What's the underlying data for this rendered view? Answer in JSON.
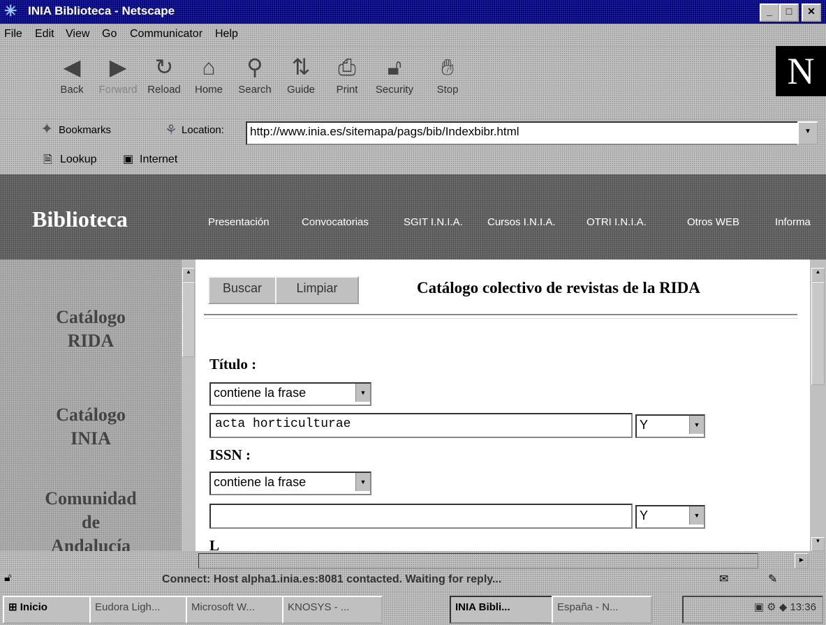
{
  "window": {
    "title": "INIA Biblioteca - Netscape",
    "minimize_glyph": "_",
    "maximize_glyph": "□",
    "close_glyph": "✕"
  },
  "menu": [
    "File",
    "Edit",
    "View",
    "Go",
    "Communicator",
    "Help"
  ],
  "toolbar": {
    "buttons": [
      {
        "label": "Back",
        "icon": "back-arrow-icon",
        "enabled": true
      },
      {
        "label": "Forward",
        "icon": "forward-arrow-icon",
        "enabled": false
      },
      {
        "label": "Reload",
        "icon": "reload-icon",
        "enabled": true
      },
      {
        "label": "Home",
        "icon": "home-icon",
        "enabled": true
      },
      {
        "label": "Search",
        "icon": "search-icon",
        "enabled": true
      },
      {
        "label": "Guide",
        "icon": "guide-icon",
        "enabled": true
      },
      {
        "label": "Print",
        "icon": "print-icon",
        "enabled": true
      },
      {
        "label": "Security",
        "icon": "security-lock-icon",
        "enabled": true
      },
      {
        "label": "Stop",
        "icon": "stop-icon",
        "enabled": true
      }
    ],
    "logo_letter": "N"
  },
  "location": {
    "bookmarks_label": "Bookmarks",
    "location_label": "Location:",
    "url": "http://www.inia.es/sitemapa/pags/bib/Indexbibr.html"
  },
  "personal_toolbar": [
    "Lookup",
    "Internet"
  ],
  "site": {
    "brand": "Biblioteca",
    "nav": [
      "Presentación",
      "Convocatorias",
      "SGIT I.N.I.A.",
      "Cursos I.N.I.A.",
      "OTRI I.N.I.A.",
      "Otros WEB",
      "Informa"
    ]
  },
  "left_nav": [
    {
      "line1": "Catálogo",
      "line2": "RIDA"
    },
    {
      "line1": "Catálogo",
      "line2": "INIA"
    },
    {
      "line1": "Comunidad",
      "line2": "de",
      "line3": "Andalucía"
    }
  ],
  "form": {
    "buscar_label": "Buscar",
    "limpiar_label": "Limpiar",
    "title": "Catálogo colectivo de revistas de la RIDA",
    "titulo_label": "Título :",
    "titulo_mode": "contiene la frase",
    "titulo_value": "acta horticulturae",
    "titulo_bool": "Y",
    "issn_label": "ISSN :",
    "issn_mode": "contiene la frase",
    "issn_value": "",
    "issn_bool": "Y",
    "next_label_partial": "L"
  },
  "status": {
    "text": "Connect: Host alpha1.inia.es:8081 contacted. Waiting for reply..."
  },
  "taskbar": {
    "start_label": "Inicio",
    "tasks": [
      "Eudora Ligh...",
      "Microsoft W...",
      "KNOSYS - ...",
      "INIA Bibli...",
      "España - N..."
    ],
    "clock": "13:36"
  },
  "colors": {
    "titlebar": "#000080",
    "header_gray": "#6e6e6e",
    "chrome_gray": "#c0c0c0"
  }
}
